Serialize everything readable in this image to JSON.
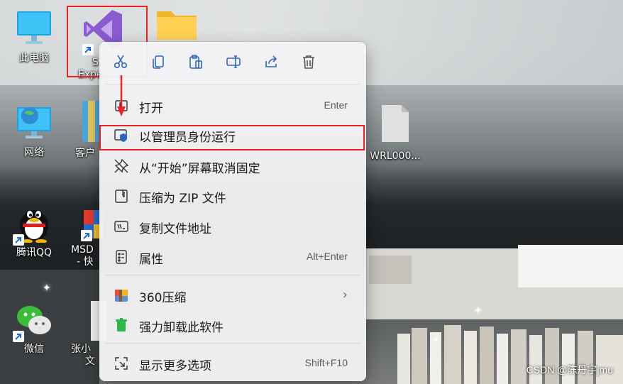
{
  "desktop_icons": [
    {
      "label": "此电脑",
      "icon": "monitor-icon"
    },
    {
      "label": "网络",
      "icon": "network-icon"
    },
    {
      "label": "腾讯QQ",
      "icon": "qq-penguin-icon"
    },
    {
      "label": "微信",
      "icon": "wechat-icon"
    },
    {
      "label": "S",
      "label2": "Expe",
      "icon": "visual-studio-icon"
    },
    {
      "label": "客户",
      "icon": "zip-archive-icon"
    },
    {
      "label": "MSD",
      "label2": "- 快",
      "icon": "msd-app-icon"
    },
    {
      "label": "张小",
      "label2": "文",
      "icon": "document-icon"
    },
    {
      "label": "",
      "icon": "folder-icon"
    },
    {
      "label": "WRL000...",
      "icon": "blank-file-icon"
    }
  ],
  "context_menu": {
    "toolbar": [
      {
        "name": "cut",
        "icon": "scissors-icon"
      },
      {
        "name": "copy",
        "icon": "copy-icon"
      },
      {
        "name": "paste",
        "icon": "paste-icon"
      },
      {
        "name": "rename",
        "icon": "rename-icon"
      },
      {
        "name": "share",
        "icon": "share-icon"
      },
      {
        "name": "delete",
        "icon": "trash-icon"
      }
    ],
    "items": [
      {
        "label": "打开",
        "shortcut": "Enter",
        "icon": "open-icon"
      },
      {
        "label": "以管理员身份运行",
        "shortcut": "",
        "icon": "admin-shield-icon"
      },
      {
        "label": "从“开始”屏幕取消固定",
        "shortcut": "",
        "icon": "unpin-icon"
      },
      {
        "label": "压缩为 ZIP 文件",
        "shortcut": "",
        "icon": "zip-folder-icon"
      },
      {
        "label": "复制文件地址",
        "shortcut": "",
        "icon": "copy-path-icon"
      },
      {
        "label": "属性",
        "shortcut": "Alt+Enter",
        "icon": "properties-icon"
      },
      {
        "label": "360压缩",
        "shortcut": "",
        "icon": "360-zip-icon",
        "has_submenu": true
      },
      {
        "label": "强力卸载此软件",
        "shortcut": "",
        "icon": "uninstall-icon"
      },
      {
        "label": "显示更多选项",
        "shortcut": "Shift+F10",
        "icon": "more-options-icon"
      }
    ]
  },
  "watermark": "CSDN @陈丹宇jmu",
  "colors": {
    "annotation_red": "#e22222",
    "menu_bg": "#f3f3f5",
    "accent_blue": "#2b66c4"
  }
}
